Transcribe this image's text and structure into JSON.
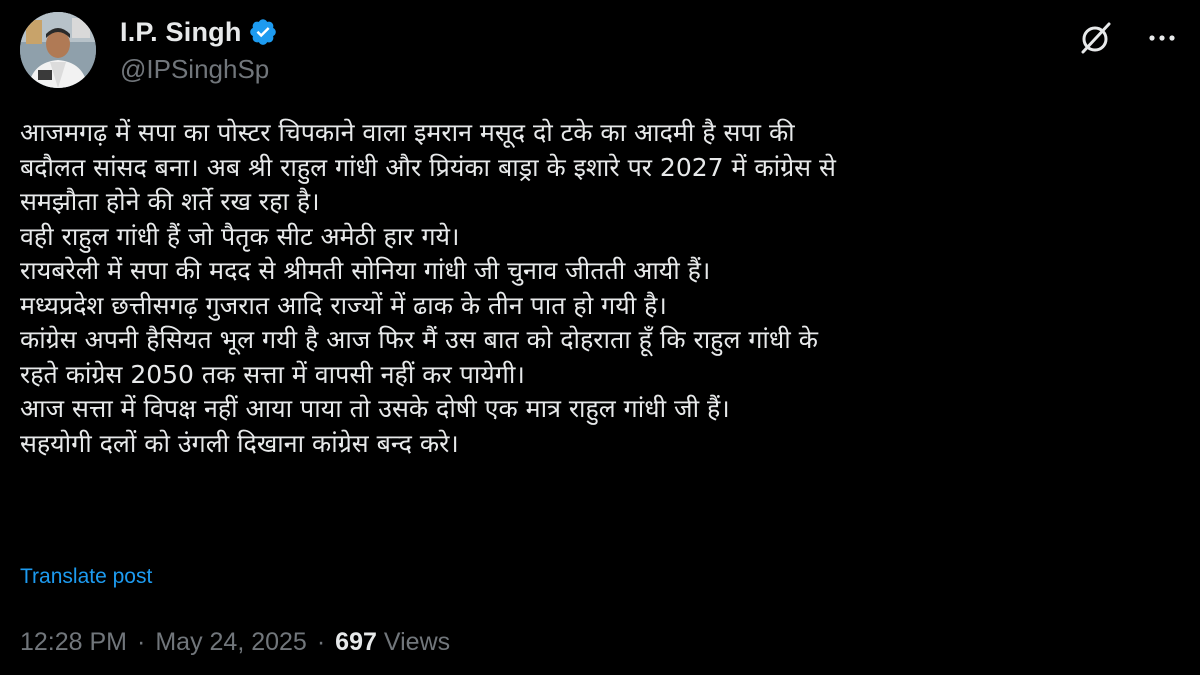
{
  "tweet": {
    "author": {
      "name": "I.P. Singh",
      "handle": "@IPSinghSp",
      "verified": true,
      "verified_color": "#1d9bf0"
    },
    "header_icons": [
      "grok-icon",
      "more-icon"
    ],
    "lines": [
      "आजमगढ़ में सपा का पोस्टर चिपकाने वाला इमरान मसूद दो टके का आदमी है सपा की",
      "बदौलत सांसद बना। अब श्री राहुल गांधी और प्रियंका बाड्रा के इशारे पर 2027 में कांग्रेस से",
      "समझौता होने की शर्ते रख रहा है।",
      "वही राहुल गांधी हैं जो पैतृक सीट अमेठी हार गये।",
      "रायबरेली में सपा की मदद से श्रीमती सोनिया गांधी जी चुनाव जीतती आयी हैं।",
      "मध्यप्रदेश छत्तीसगढ़ गुजरात आदि राज्यों में ढाक के तीन पात हो गयी है।",
      "कांग्रेस अपनी हैसियत भूल गयी है आज फिर मैं उस बात को दोहराता हूँ कि राहुल गांधी के",
      "रहते कांग्रेस 2050 तक सत्ता में वापसी नहीं कर पायेगी।",
      "आज सत्ता में विपक्ष नहीं आया पाया तो उसके दोषी एक मात्र राहुल गांधी जी हैं।",
      "सहयोगी दलों को उंगली दिखाना कांग्रेस बन्द करे।"
    ],
    "translate_label": "Translate post",
    "time": "12:28 PM",
    "separator": "·",
    "date": "May 24, 2025",
    "views_count": "697",
    "views_label": "Views",
    "colors": {
      "background": "#000000",
      "text": "#e7e9ea",
      "secondary": "#71767b",
      "link": "#1d9bf0"
    }
  }
}
